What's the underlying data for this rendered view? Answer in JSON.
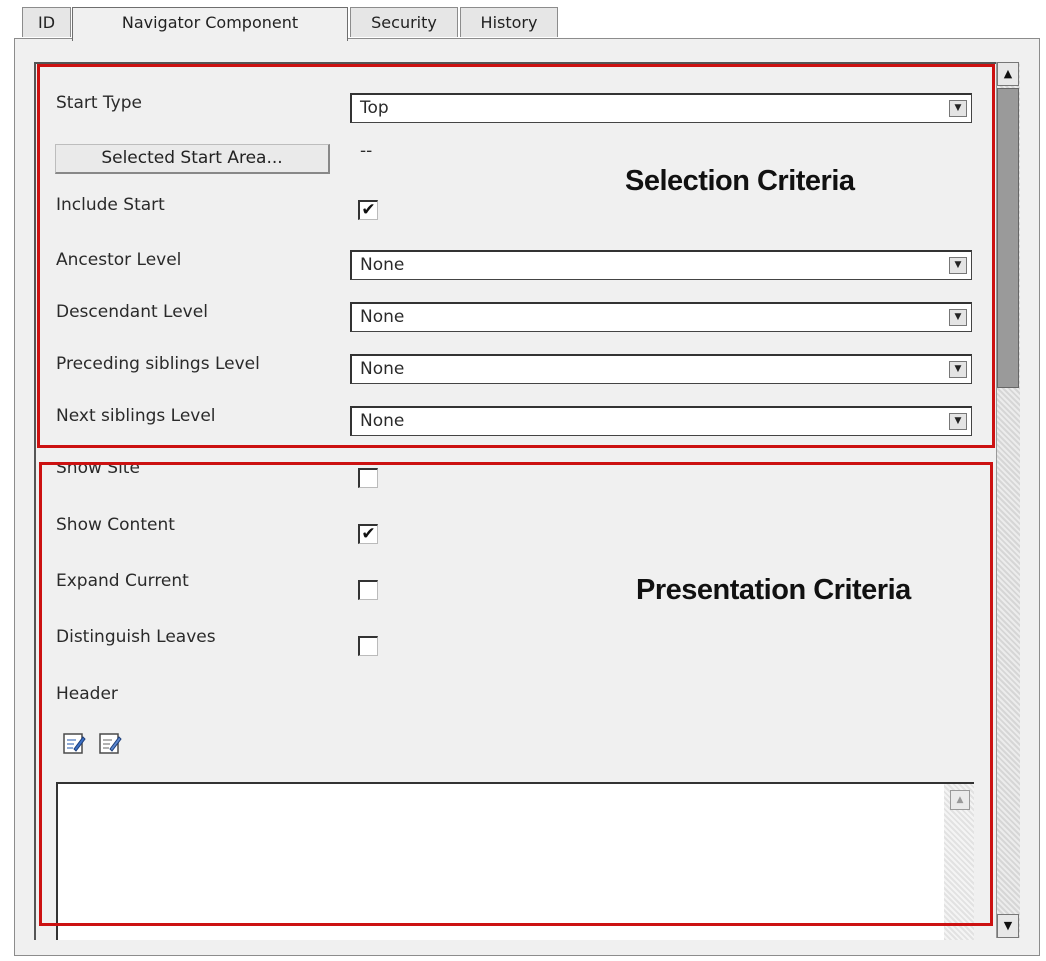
{
  "tabs": [
    {
      "label": "ID",
      "active": false
    },
    {
      "label": "Navigator Component",
      "active": true
    },
    {
      "label": "Security",
      "active": false
    },
    {
      "label": "History",
      "active": false
    }
  ],
  "selection": {
    "annotation": "Selection Criteria",
    "start_type": {
      "label": "Start Type",
      "value": "Top"
    },
    "start_area_button": "Selected Start Area...",
    "start_area_value": "--",
    "include_start": {
      "label": "Include Start",
      "checked": true
    },
    "ancestor_level": {
      "label": "Ancestor Level",
      "value": "None"
    },
    "descendant_level": {
      "label": "Descendant Level",
      "value": "None"
    },
    "preceding_siblings_level": {
      "label": "Preceding siblings Level",
      "value": "None"
    },
    "next_siblings_level": {
      "label": "Next siblings Level",
      "value": "None"
    }
  },
  "presentation": {
    "annotation": "Presentation Criteria",
    "show_site": {
      "label": "Show Site",
      "checked": false
    },
    "show_content": {
      "label": "Show Content",
      "checked": true
    },
    "expand_current": {
      "label": "Expand Current",
      "checked": false
    },
    "distinguish_leaves": {
      "label": "Distinguish Leaves",
      "checked": false
    },
    "header_label": "Header",
    "header_text": ""
  },
  "glyphs": {
    "check": "✔",
    "dropdown_arrow": "▼",
    "scroll_up": "▲",
    "scroll_down": "▼"
  },
  "colors": {
    "annotation_box": "#cc1111",
    "panel_bg": "#f0f0f0"
  },
  "icons": [
    "edit-html-icon",
    "edit-text-icon"
  ]
}
